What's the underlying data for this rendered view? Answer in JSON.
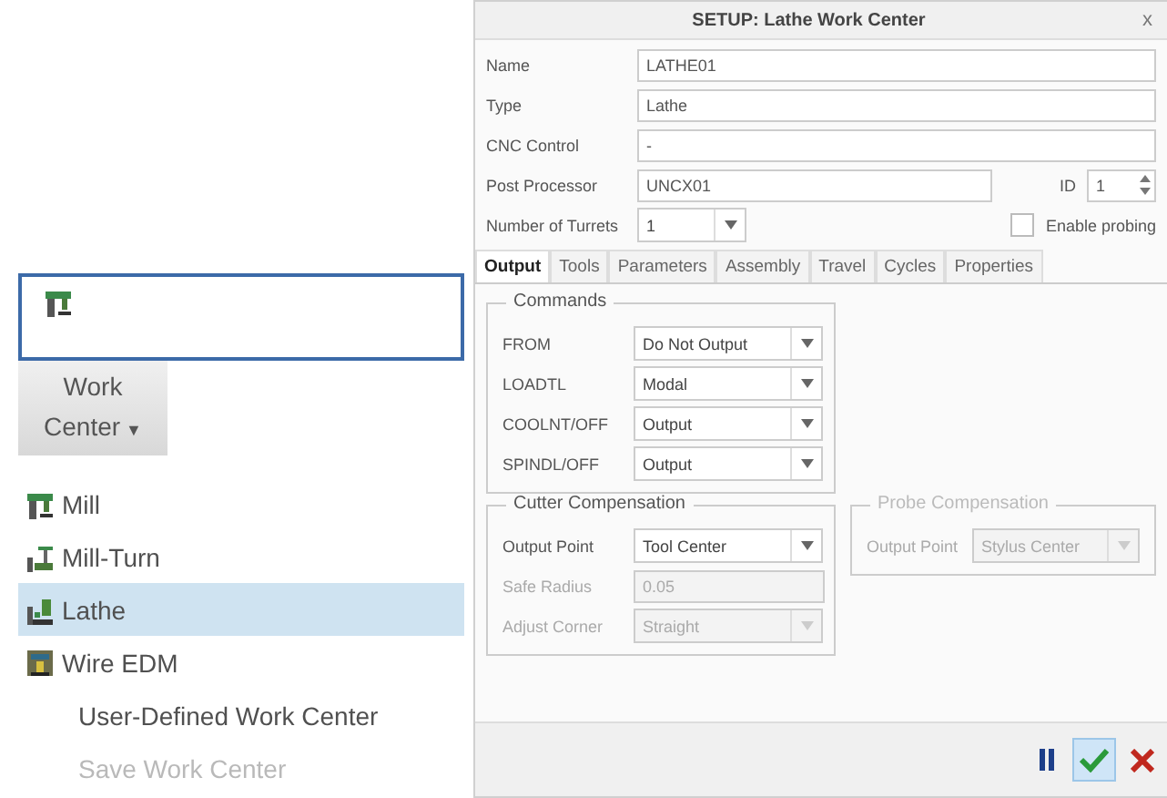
{
  "ribbon": {
    "button": {
      "label": "Work Center",
      "caret": "▼"
    }
  },
  "menu": [
    {
      "label": "Mill",
      "kind": "mill",
      "selected": false,
      "disabled": false
    },
    {
      "label": "Mill-Turn",
      "kind": "millturn",
      "selected": false,
      "disabled": false
    },
    {
      "label": "Lathe",
      "kind": "lathe",
      "selected": true,
      "disabled": false
    },
    {
      "label": "Wire EDM",
      "kind": "edm",
      "selected": false,
      "disabled": false
    },
    {
      "label": "User-Defined Work Center",
      "kind": "none",
      "selected": false,
      "disabled": false
    },
    {
      "label": "Save Work Center",
      "kind": "none",
      "selected": false,
      "disabled": true
    }
  ],
  "dialog": {
    "title": "SETUP: Lathe Work Center",
    "close": "x",
    "fields": [
      {
        "label": "Name",
        "value": "LATHE01"
      },
      {
        "label": "Type",
        "value": "Lathe"
      },
      {
        "label": "CNC Control",
        "value": "-"
      }
    ],
    "post_processor": {
      "label": "Post Processor",
      "value": "UNCX01"
    },
    "id": {
      "label": "ID",
      "value": "1"
    },
    "turrets": {
      "label": "Number of Turrets",
      "value": "1"
    },
    "probing": {
      "label": "Enable probing",
      "checked": false
    },
    "tabs": [
      {
        "label": "Output",
        "selected": true
      },
      {
        "label": "Tools",
        "selected": false
      },
      {
        "label": "Parameters",
        "selected": false
      },
      {
        "label": "Assembly",
        "selected": false
      },
      {
        "label": "Travel",
        "selected": false
      },
      {
        "label": "Cycles",
        "selected": false
      },
      {
        "label": "Properties",
        "selected": false
      }
    ],
    "commands": {
      "title": "Commands",
      "rows": [
        {
          "label": "FROM",
          "value": "Do Not Output",
          "kind": "select",
          "disabled": false
        },
        {
          "label": "LOADTL",
          "value": "Modal",
          "kind": "select",
          "disabled": false
        },
        {
          "label": "COOLNT/OFF",
          "value": "Output",
          "kind": "select",
          "disabled": false
        },
        {
          "label": "SPINDL/OFF",
          "value": "Output",
          "kind": "select",
          "disabled": false
        }
      ]
    },
    "cutter": {
      "title": "Cutter Compensation",
      "disabled": false,
      "rows": [
        {
          "label": "Output Point",
          "value": "Tool Center",
          "kind": "select",
          "disabled": false
        },
        {
          "label": "Safe Radius",
          "value": "0.05",
          "kind": "input",
          "disabled": true
        },
        {
          "label": "Adjust Corner",
          "value": "Straight",
          "kind": "select",
          "disabled": true
        }
      ]
    },
    "probe": {
      "title": "Probe Compensation",
      "disabled": true,
      "rows": [
        {
          "label": "Output Point",
          "value": "Stylus Center",
          "kind": "select",
          "disabled": true
        }
      ]
    },
    "footer": [
      {
        "kind": "pause",
        "highlighted": false
      },
      {
        "kind": "ok",
        "highlighted": true
      },
      {
        "kind": "cancel",
        "highlighted": false
      }
    ]
  }
}
